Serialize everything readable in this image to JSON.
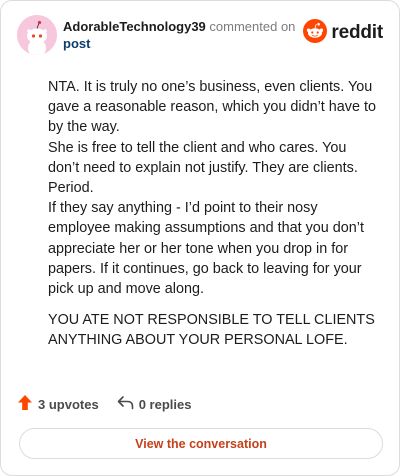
{
  "header": {
    "username": "AdorableTechnology39",
    "action": "commented on",
    "post_link": "post",
    "brand": "reddit"
  },
  "comment": {
    "paragraphs": [
      [
        "NTA. It is truly no one’s business, even clients. You gave a reasonable reason, which you didn’t have to by the way.",
        "She is free to tell the client and who cares. You don’t need to explain not justify. They are clients. Period.",
        "If they say anything - I’d point to their nosy employee making assumptions and that you don’t appreciate her or her tone when you drop in for papers. If it continues, go back to leaving for your pick up and move along."
      ],
      [
        "YOU ATE NOT RESPONSIBLE TO TELL CLIENTS ANYTHING ABOUT YOUR PERSONAL LOFE."
      ]
    ]
  },
  "stats": {
    "upvotes": "3 upvotes",
    "replies": "0 replies"
  },
  "cta": {
    "label": "View the conversation"
  },
  "colors": {
    "accent": "#c5411b",
    "upvote": "#ff4500",
    "avatar_bg": "#f7c7dd",
    "link": "#0f3c6e"
  },
  "icons": {
    "upvote": "upvote-arrow-icon",
    "reply": "reply-arrow-icon",
    "brand": "reddit-logo-icon",
    "avatar": "snoo-avatar-icon"
  }
}
